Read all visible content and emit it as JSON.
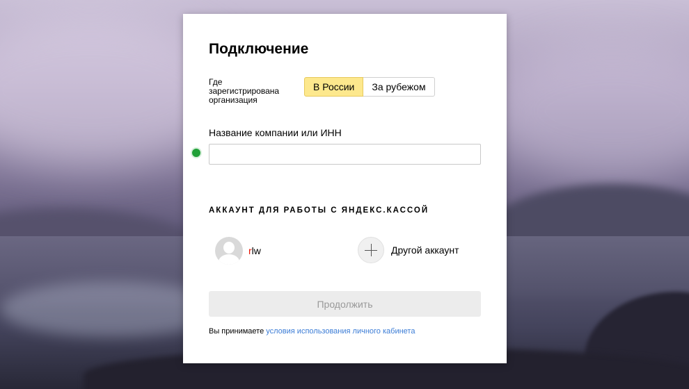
{
  "form": {
    "title": "Подключение",
    "registration_label": "Где\nзарегистрирована\nорганизация",
    "registration_options": [
      "В России",
      "За рубежом"
    ],
    "registration_selected": "В России",
    "company_field_label": "Название компании или ИНН",
    "company_field_value": ""
  },
  "accounts": {
    "section_title": "АККАУНТ ДЛЯ РАБОТЫ С ЯНДЕКС.КАССОЙ",
    "current": {
      "name_first_letter": "r",
      "name_rest": "lw"
    },
    "other_label": "Другой аккаунт"
  },
  "actions": {
    "continue_label": "Продолжить"
  },
  "terms": {
    "prefix": "Вы принимаете ",
    "link_text": "условия использования личного кабинета"
  },
  "colors": {
    "selected_option": "#fde88d",
    "status_dot": "#21a038",
    "link": "#3b7cd6",
    "account_initial": "#e61400",
    "disabled_button": "#ececec"
  }
}
